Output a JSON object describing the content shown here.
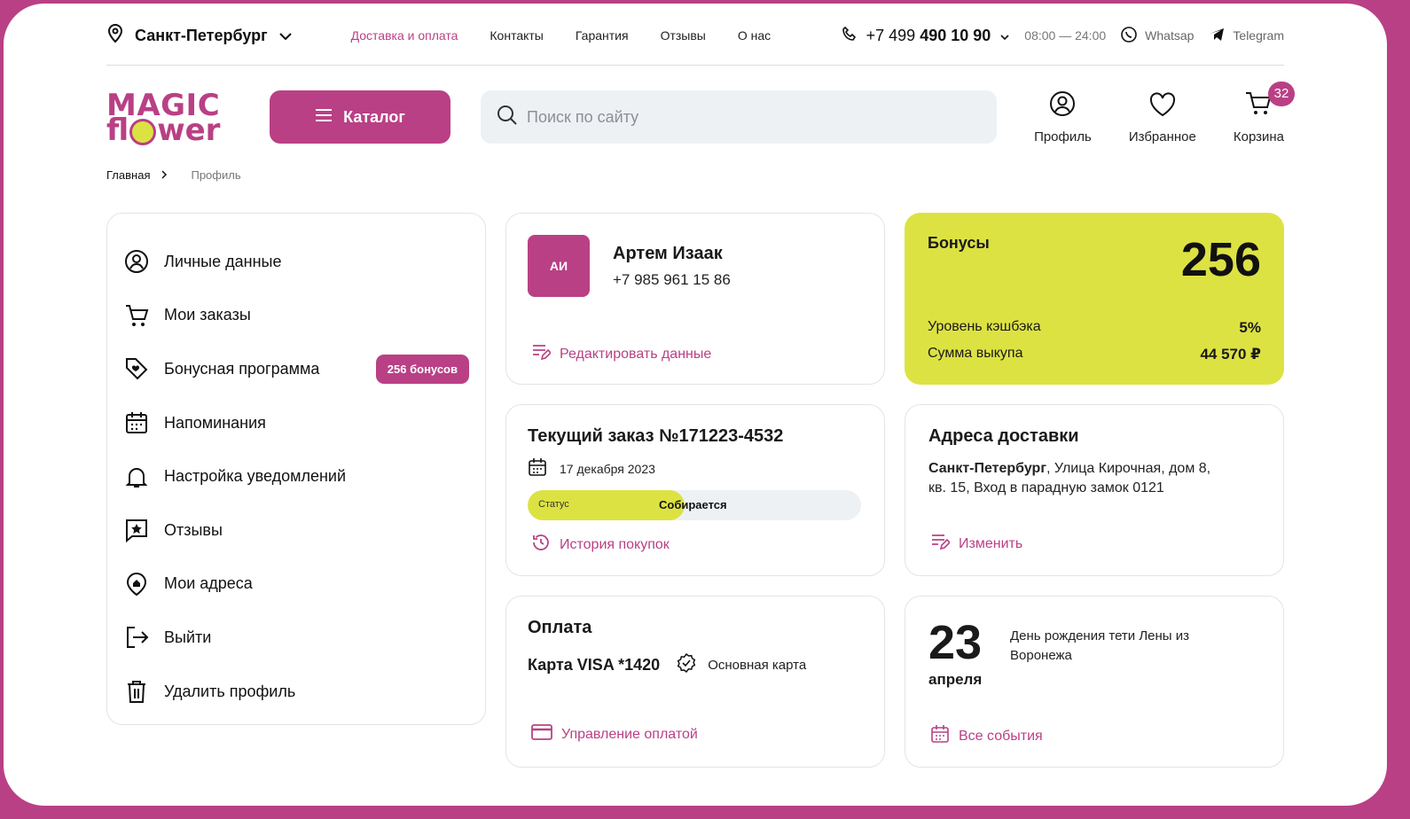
{
  "topbar": {
    "city": "Санкт-Петербург",
    "nav": [
      "Доставка и оплата",
      "Контакты",
      "Гарантия",
      "Отзывы",
      "О нас"
    ],
    "phone_prefix": "+7 499",
    "phone_main": "490 10 90",
    "hours": "08:00 — 24:00",
    "whatsapp": "Whatsap",
    "telegram": "Telegram"
  },
  "header": {
    "logo_line1": "MAGIC",
    "logo_line2_a": "fl",
    "logo_line2_b": "wer",
    "catalog": "Каталог",
    "search_placeholder": "Поиск по сайту",
    "profile": "Профиль",
    "favorites": "Избранное",
    "cart": "Корзина",
    "cart_count": "32"
  },
  "breadcrumb": {
    "home": "Главная",
    "current": "Профиль"
  },
  "sidebar": {
    "items": [
      {
        "label": "Личные данные",
        "icon": "user-circle-icon"
      },
      {
        "label": "Мои заказы",
        "icon": "cart-icon"
      },
      {
        "label": "Бонусная программа",
        "icon": "tag-heart-icon",
        "pill": "256 бонусов"
      },
      {
        "label": "Напоминания",
        "icon": "calendar-icon"
      },
      {
        "label": "Настройка уведомлений",
        "icon": "bell-icon"
      },
      {
        "label": "Отзывы",
        "icon": "star-message-icon"
      },
      {
        "label": "Мои адреса",
        "icon": "location-home-icon"
      },
      {
        "label": "Выйти",
        "icon": "logout-icon"
      },
      {
        "label": "Удалить профиль",
        "icon": "trash-icon"
      }
    ]
  },
  "profile": {
    "initials": "АИ",
    "name": "Артем Изаак",
    "phone": "+7 985 961 15 86",
    "edit": "Редактировать данные"
  },
  "bonus": {
    "title": "Бонусы",
    "value": "256",
    "cashback_label": "Уровень кэшбэка",
    "cashback_value": "5%",
    "sum_label": "Сумма выкупа",
    "sum_value": "44 570 ₽"
  },
  "order": {
    "title": "Текущий заказ №171223-4532",
    "date": "17 декабря 2023",
    "status_label": "Статус",
    "status_value": "Собирается",
    "status_progress": 0.47,
    "history": "История покупок"
  },
  "address": {
    "title": "Адреса доставки",
    "city": "Санкт-Петербург",
    "rest": ", Улица Кирочная, дом 8, кв. 15, Вход в парадную замок 0121",
    "change": "Изменить"
  },
  "payment": {
    "title": "Оплата",
    "card": "Карта VISA *1420",
    "main": "Основная карта",
    "manage": "Управление оплатой"
  },
  "event": {
    "day": "23",
    "month": "апреля",
    "text": "День рождения тети Лены из Воронежа",
    "all": "Все события"
  },
  "colors": {
    "accent": "#b94085",
    "lime": "#dde243",
    "search_bg": "#eef1f4"
  }
}
